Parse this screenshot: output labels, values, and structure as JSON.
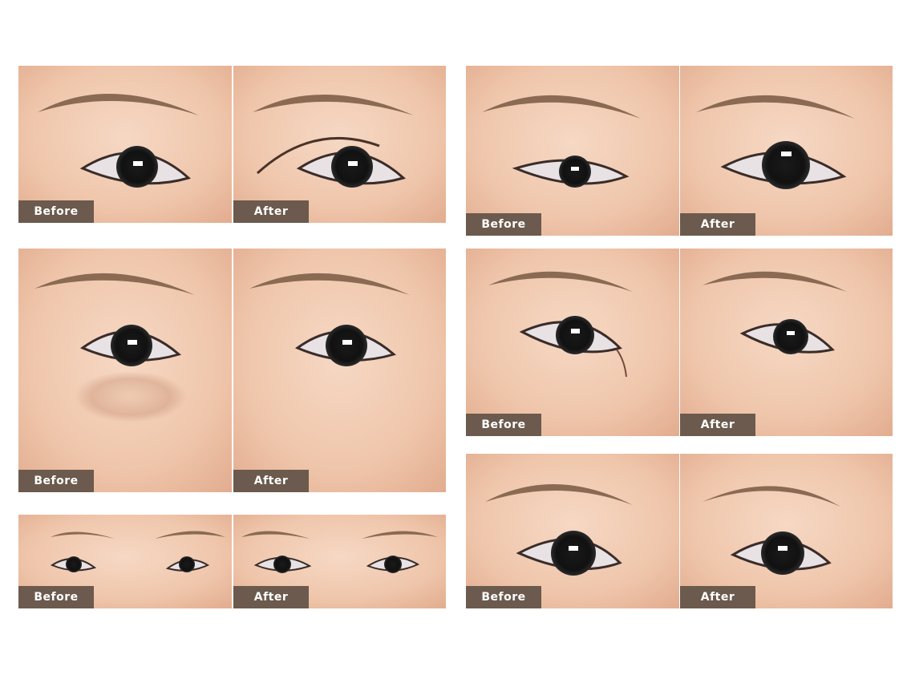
{
  "labels": {
    "before": "Before",
    "after": "After"
  },
  "colors": {
    "label_bg": "#6b5a4d",
    "skin_light": "#f2cdb6",
    "skin_dark": "#e2ad92",
    "brow": "#8a6a52"
  },
  "figures": [
    {
      "id": "double-eyelid",
      "before": "Before",
      "after": "After"
    },
    {
      "id": "eye-bag-removal",
      "before": "Before",
      "after": "After"
    },
    {
      "id": "epicanthoplasty-wide",
      "before": "Before",
      "after": "After"
    },
    {
      "id": "eye-enlargement",
      "before": "Before",
      "after": "After"
    },
    {
      "id": "inner-corner",
      "before": "Before",
      "after": "After"
    },
    {
      "id": "brow-lift",
      "before": "Before",
      "after": "After"
    }
  ]
}
